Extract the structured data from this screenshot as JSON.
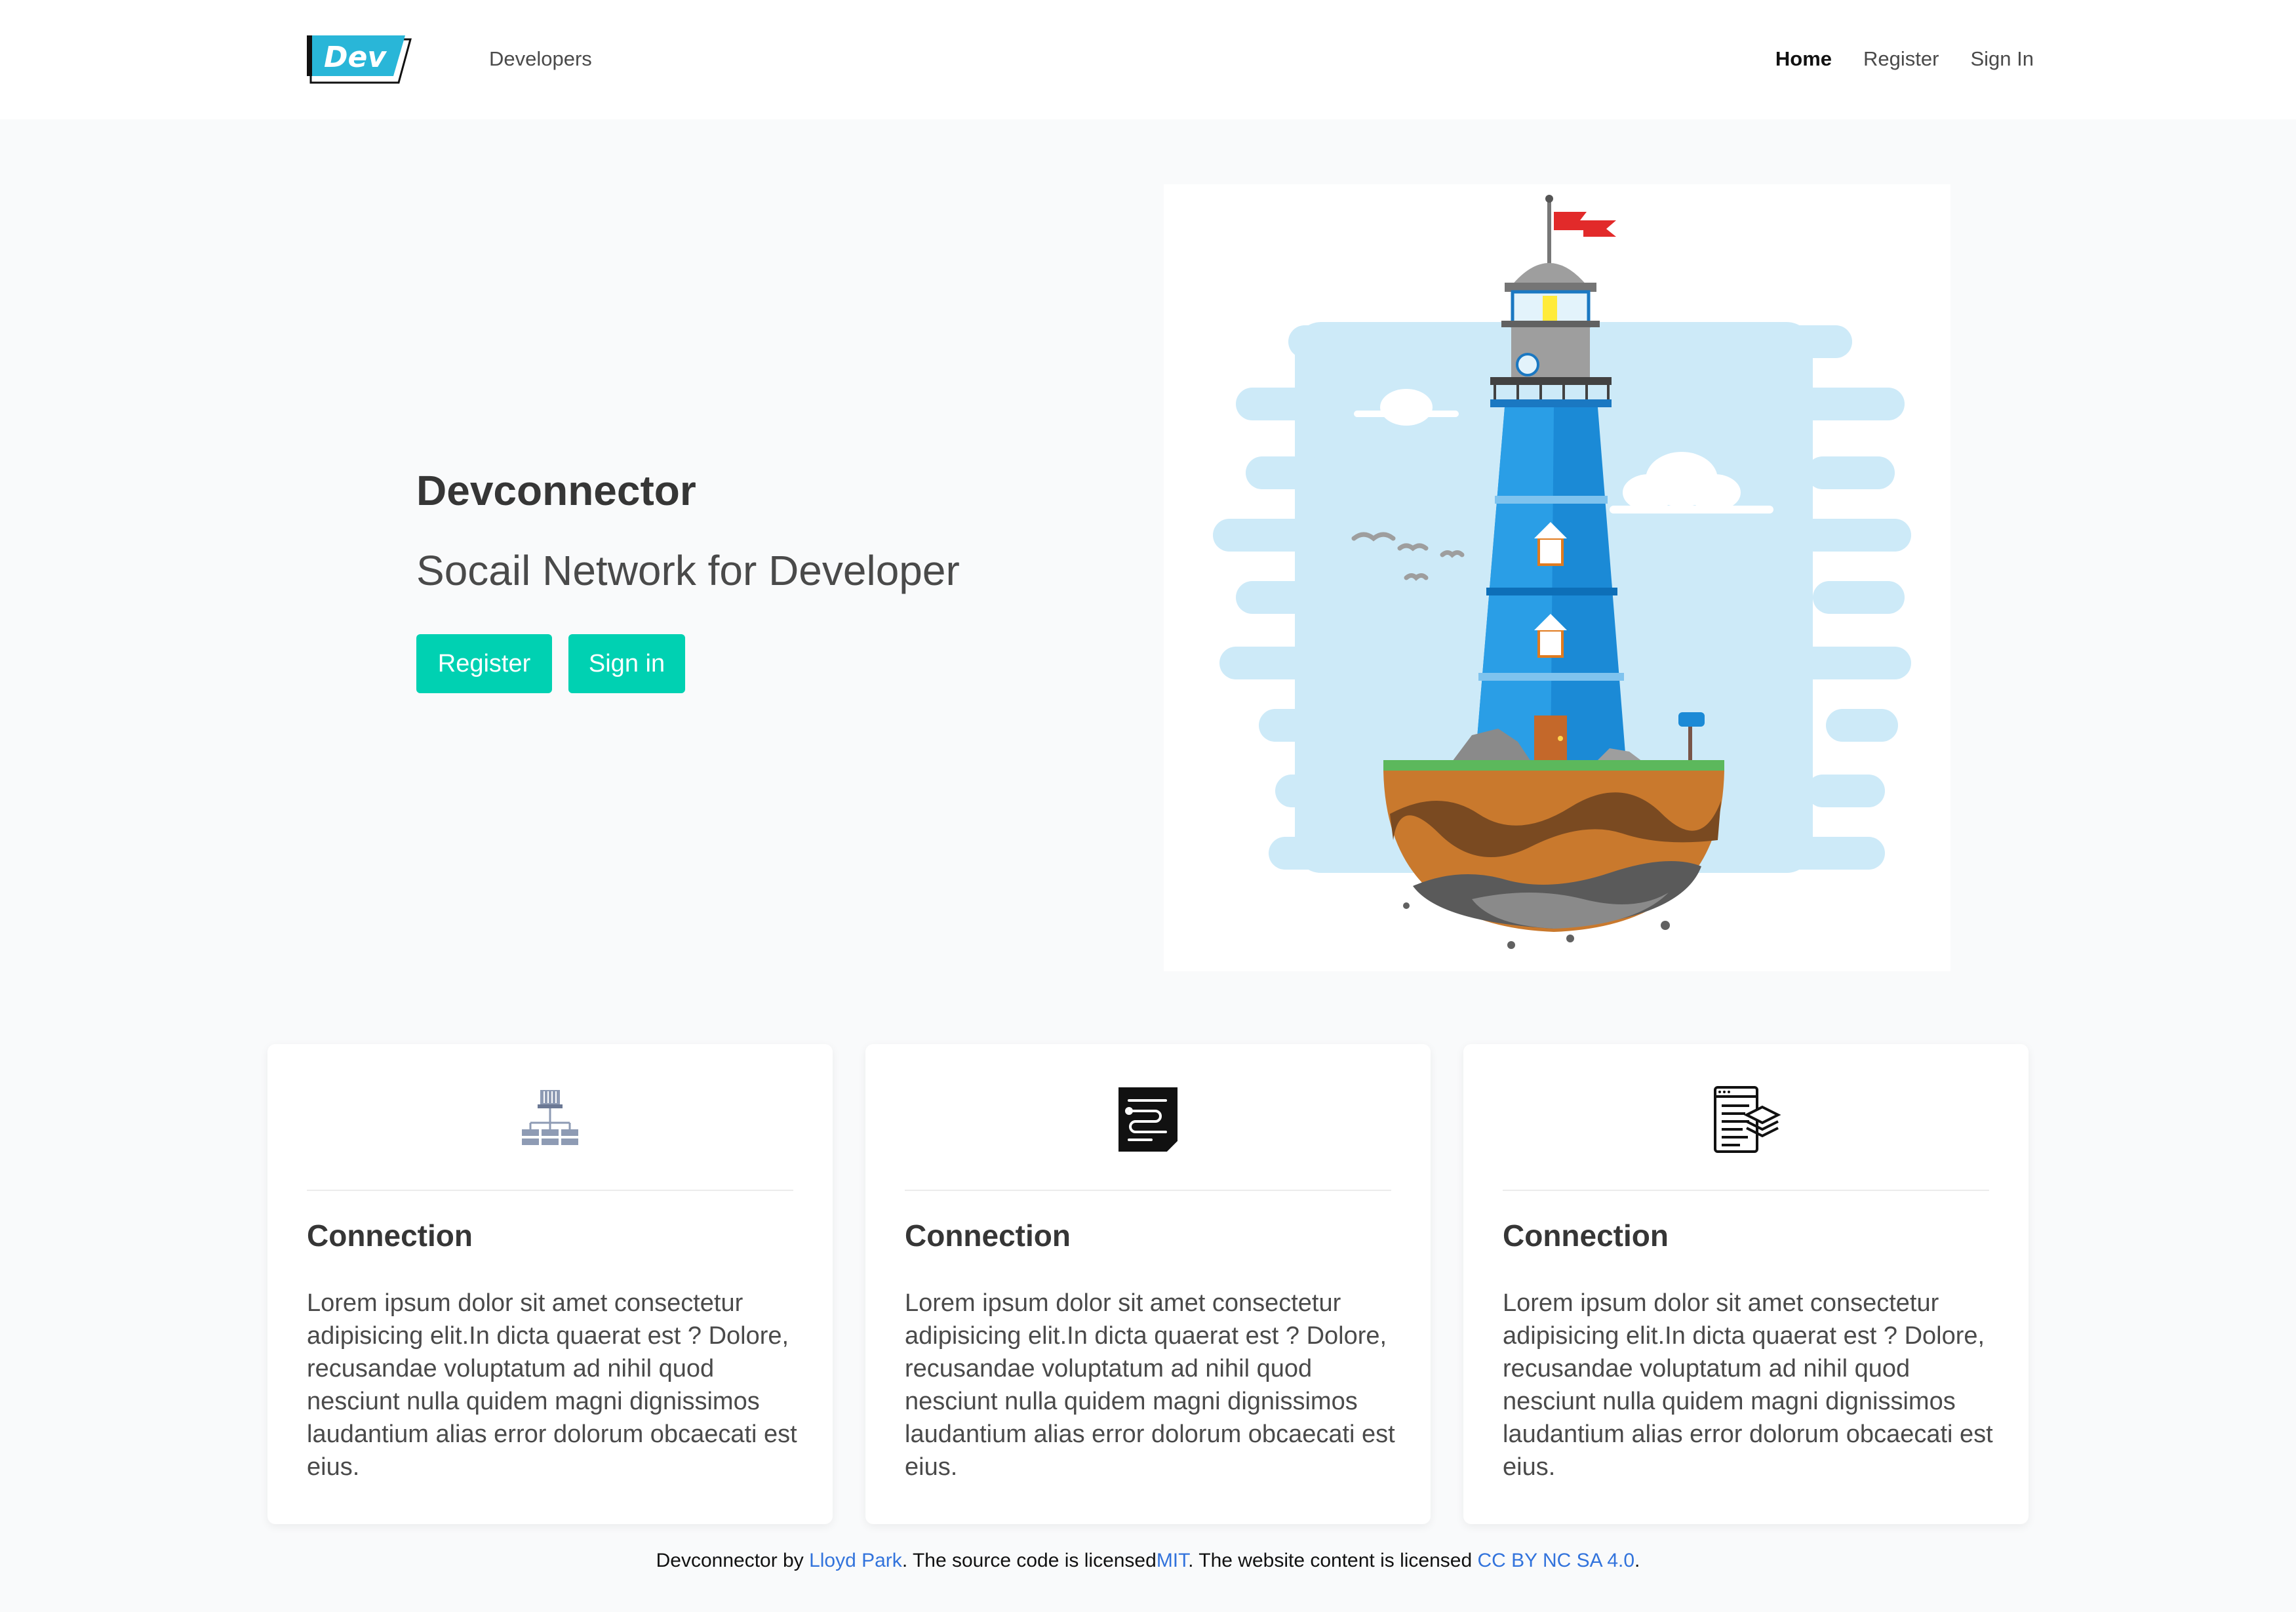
{
  "nav": {
    "logo_text": "Dev",
    "developers": "Developers",
    "links": [
      "Home",
      "Register",
      "Sign In"
    ],
    "active": "Home"
  },
  "hero": {
    "title": "Devconnector",
    "subtitle": "Socail Network for Developer",
    "register_label": "Register",
    "signin_label": "Sign in"
  },
  "cards": [
    {
      "icon": "server-network-icon",
      "title": "Connection",
      "text": "Lorem ipsum dolor sit amet consectetur adipisicing elit.In dicta quaerat est ? Dolore, recusandae voluptatum ad nihil quod nesciunt nulla quidem magni dignissimos laudantium alias error dolorum obcaecati est eius."
    },
    {
      "icon": "code-document-icon",
      "title": "Connection",
      "text": "Lorem ipsum dolor sit amet consectetur adipisicing elit.In dicta quaerat est ? Dolore, recusandae voluptatum ad nihil quod nesciunt nulla quidem magni dignissimos laudantium alias error dolorum obcaecati est eius."
    },
    {
      "icon": "document-layers-icon",
      "title": "Connection",
      "text": "Lorem ipsum dolor sit amet consectetur adipisicing elit.In dicta quaerat est ? Dolore, recusandae voluptatum ad nihil quod nesciunt nulla quidem magni dignissimos laudantium alias error dolorum obcaecati est eius."
    }
  ],
  "footer": {
    "part1": "Devconnector by ",
    "author_link": "Lloyd Park",
    "part2": ". The source code is licensed",
    "license_link": "MIT",
    "part3": ". The website content is licensed ",
    "content_license_link": "CC BY NC SA 4.0",
    "part4": "."
  },
  "colors": {
    "primary": "#00d1b2",
    "link": "#3273dc",
    "logo_blue": "#29b6d8"
  }
}
